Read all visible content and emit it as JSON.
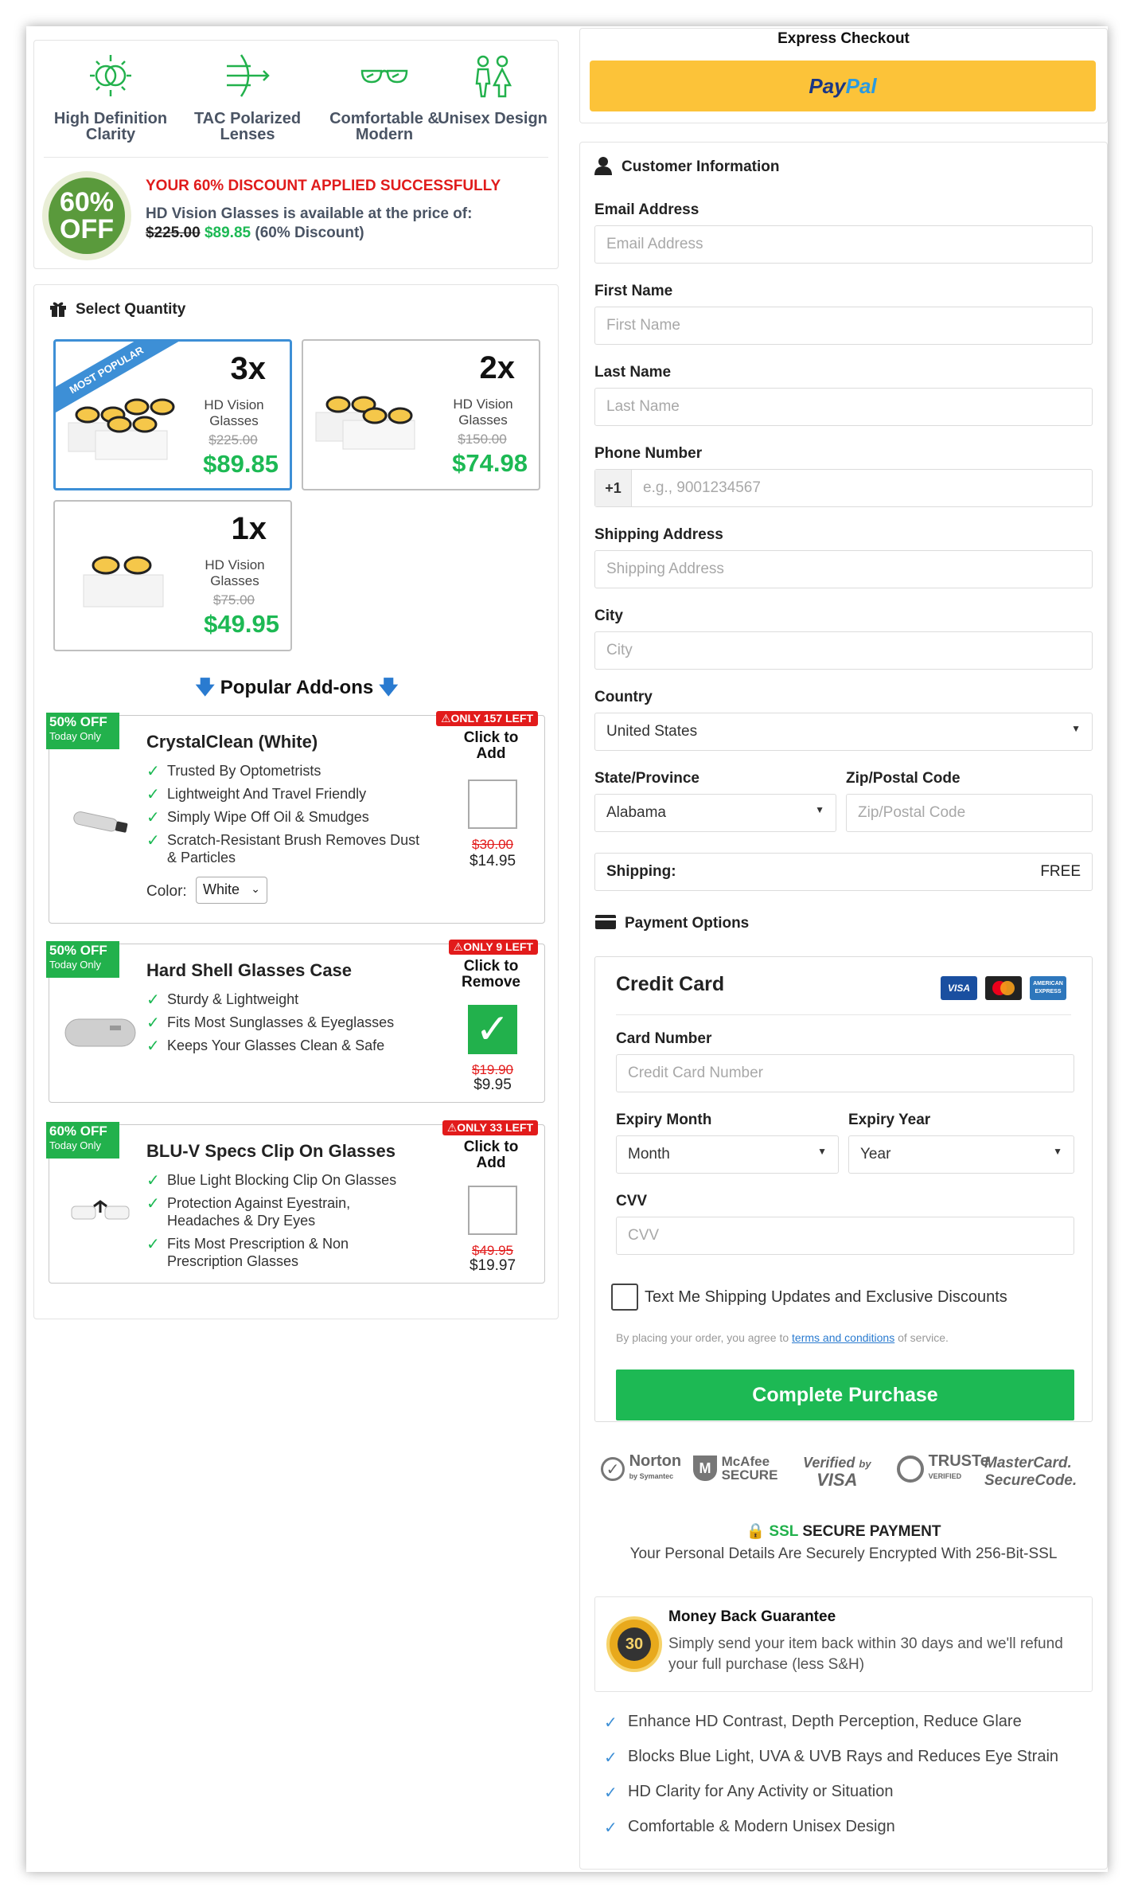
{
  "features": [
    {
      "icon": "hd-clarity-icon",
      "label": "High Definition Clarity"
    },
    {
      "icon": "polarized-lens-icon",
      "label": "TAC Polarized Lenses"
    },
    {
      "icon": "glasses-icon",
      "label": "Comfortable & Modern"
    },
    {
      "icon": "unisex-icon",
      "label": "Unisex Design"
    }
  ],
  "discount": {
    "badge_pct": "60%",
    "badge_off": "OFF",
    "title": "YOUR 60% DISCOUNT APPLIED SUCCESSFULLY",
    "line_prefix": "HD Vision Glasses is available at the price of:",
    "old_price": "$225.00",
    "new_price": "$89.85",
    "suffix": "(60% Discount)"
  },
  "quantity": {
    "title": "Select Quantity",
    "ribbon": "MOST POPULAR",
    "options": [
      {
        "qty": "3x",
        "name": "HD Vision Glasses",
        "old": "$225.00",
        "price": "$89.85",
        "selected": true
      },
      {
        "qty": "2x",
        "name": "HD Vision Glasses",
        "old": "$150.00",
        "price": "$74.98",
        "selected": false
      },
      {
        "qty": "1x",
        "name": "HD Vision Glasses",
        "old": "$75.00",
        "price": "$49.95",
        "selected": false
      }
    ]
  },
  "addons": {
    "title": "Popular Add-ons",
    "items": [
      {
        "off": "50% OFF",
        "today": "Today Only",
        "left": "ONLY 157 LEFT",
        "name": "CrystalClean (White)",
        "bullets": [
          "Trusted By Optometrists",
          "Lightweight And Travel Friendly",
          "Simply Wipe Off Oil & Smudges",
          "Scratch-Resistant Brush Removes Dust & Particles"
        ],
        "click": "Click to Add",
        "checked": false,
        "old": "$30.00",
        "price": "$14.95",
        "color_label": "Color:",
        "color_value": "White"
      },
      {
        "off": "50% OFF",
        "today": "Today Only",
        "left": "ONLY 9 LEFT",
        "name": "Hard Shell Glasses Case",
        "bullets": [
          "Sturdy & Lightweight",
          "Fits Most Sunglasses & Eyeglasses",
          "Keeps Your Glasses Clean & Safe"
        ],
        "click": "Click to Remove",
        "checked": true,
        "old": "$19.90",
        "price": "$9.95"
      },
      {
        "off": "60% OFF",
        "today": "Today Only",
        "left": "ONLY 33 LEFT",
        "name": "BLU-V Specs Clip On Glasses",
        "bullets": [
          "Blue Light Blocking Clip On Glasses",
          "Protection Against Eyestrain, Headaches & Dry Eyes",
          "Fits Most Prescription & Non Prescription Glasses"
        ],
        "click": "Click to Add",
        "checked": false,
        "old": "$49.95",
        "price": "$19.97"
      }
    ]
  },
  "express": {
    "title": "Express Checkout",
    "paypal_a": "Pay",
    "paypal_b": "Pal"
  },
  "customer": {
    "title": "Customer Information",
    "email_label": "Email Address",
    "email_ph": "Email Address",
    "first_label": "First Name",
    "first_ph": "First Name",
    "last_label": "Last Name",
    "last_ph": "Last Name",
    "phone_label": "Phone Number",
    "phone_code": "+1",
    "phone_ph": "e.g., 9001234567",
    "address_label": "Shipping Address",
    "address_ph": "Shipping Address",
    "city_label": "City",
    "city_ph": "City",
    "country_label": "Country",
    "country_value": "United States",
    "state_label": "State/Province",
    "state_value": "Alabama",
    "zip_label": "Zip/Postal Code",
    "zip_ph": "Zip/Postal Code",
    "shipping_label": "Shipping:",
    "shipping_value": "FREE"
  },
  "payment": {
    "title": "Payment Options",
    "method": "Credit Card",
    "card_label": "Card Number",
    "card_ph": "Credit Card Number",
    "month_label": "Expiry Month",
    "month_value": "Month",
    "year_label": "Expiry Year",
    "year_value": "Year",
    "cvv_label": "CVV",
    "cvv_ph": "CVV",
    "sms_label": "Text Me Shipping Updates and Exclusive Discounts",
    "terms_prefix": "By placing your order, you agree to",
    "terms_link": "terms and conditions",
    "terms_suffix": "of service.",
    "button": "Complete Purchase",
    "card_icons": [
      "visa-icon",
      "mastercard-icon",
      "amex-icon"
    ],
    "amex_text": "AMERICAN EXPRESS"
  },
  "trust": {
    "norton": "Norton",
    "norton_sub": "by Symantec",
    "mcafee": "McAfee",
    "mcafee_sub": "SECURE",
    "visa_a": "Verified",
    "visa_by": "by",
    "visa_b": "VISA",
    "truste": "TRUSTe",
    "truste_sub": "VERIFIED",
    "mc_a": "MasterCard.",
    "mc_b": "SecureCode."
  },
  "ssl": {
    "title_a": "SSL",
    "title_b": "SECURE PAYMENT",
    "text": "Your Personal Details Are Securely Encrypted With 256-Bit-SSL"
  },
  "guarantee": {
    "title": "Money Back Guarantee",
    "text": "Simply send your item back within 30 days and we'll refund your full purchase (less S&H)",
    "seal_number": "30"
  },
  "benefits": [
    "Enhance HD Contrast, Depth Perception, Reduce Glare",
    "Blocks Blue Light, UVA & UVB Rays and Reduces Eye Strain",
    "HD Clarity for Any Activity or Situation",
    "Comfortable & Modern Unisex Design"
  ],
  "colors": {
    "accent_green": "#1db954",
    "accent_blue": "#3d8fd6",
    "alert_red": "#e21b1b",
    "paypal_yellow": "#fcc339"
  }
}
